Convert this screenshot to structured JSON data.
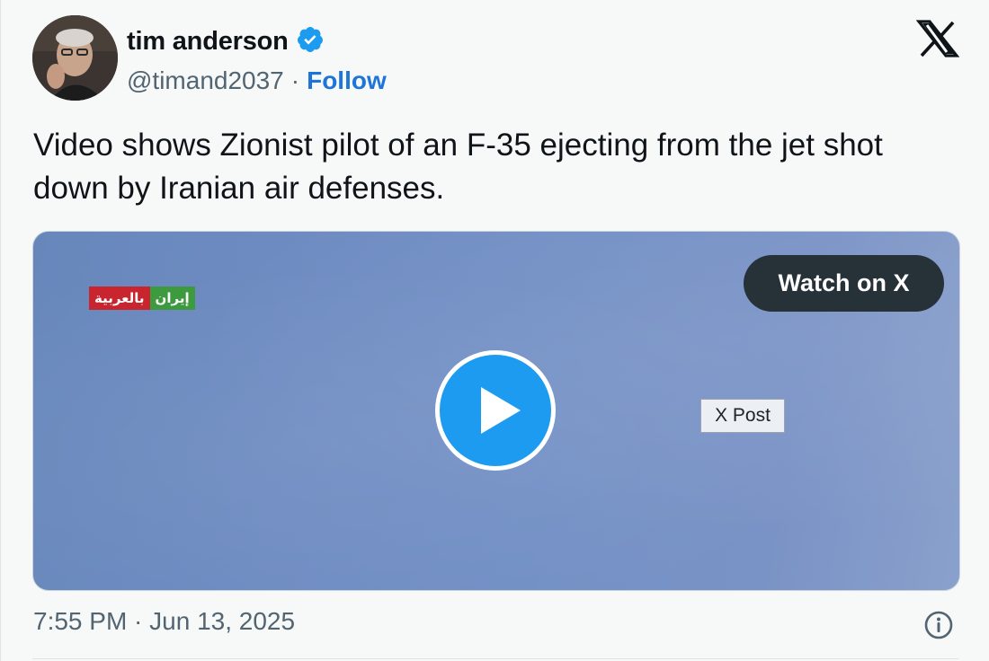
{
  "author": {
    "name": "tim anderson",
    "verified_icon": "verified-badge-icon",
    "handle": "@timand2037",
    "separator": "·",
    "follow_label": "Follow"
  },
  "platform_logo": "x-logo-icon",
  "tweet": {
    "text": "Video shows Zionist pilot of an F-35 ejecting from the jet shot down by Iranian air defenses."
  },
  "media": {
    "watermark_red": "بالعربية",
    "watermark_green": "إيران",
    "watch_label": "Watch on X",
    "play_icon": "play-icon",
    "tooltip": "X Post"
  },
  "footer": {
    "timestamp": "7:55 PM · Jun 13, 2025",
    "info_icon": "info-icon"
  },
  "colors": {
    "accent": "#1d9bf0",
    "follow": "#1d74d9",
    "watch_button": "#263238",
    "text_primary": "#0f1419",
    "text_secondary": "#536471",
    "media_bg": "#6f8cc2"
  }
}
